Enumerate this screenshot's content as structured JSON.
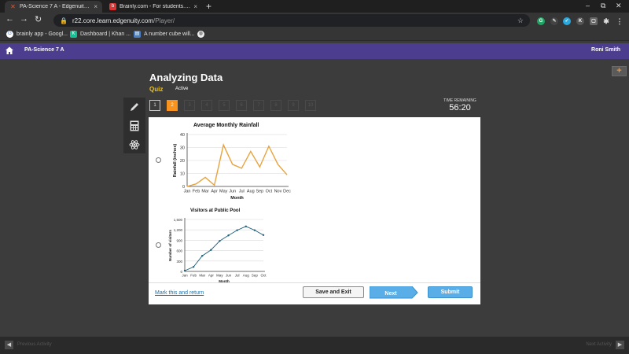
{
  "browser": {
    "tabs": [
      {
        "title": "PA-Science 7 A - Edgenuity.com",
        "active": true
      },
      {
        "title": "Brainly.com - For students. By st",
        "active": false
      }
    ],
    "url_host": "r22.core.learn.edgenuity.com",
    "url_path": "/Player/",
    "bookmarks": [
      "brainly app - Googl...",
      "Dashboard | Khan ...",
      "A number cube will..."
    ]
  },
  "header": {
    "course": "PA-Science 7 A",
    "user": "Roni Smith"
  },
  "activity": {
    "title": "Analyzing Data",
    "type": "Quiz",
    "status": "Active"
  },
  "questions": [
    "1",
    "2",
    "3",
    "4",
    "5",
    "6",
    "7",
    "8",
    "9",
    "10"
  ],
  "current_question": 2,
  "timer": {
    "label": "TIME REMAINING",
    "value": "56:20"
  },
  "footer": {
    "mark_link": "Mark this and return",
    "save_exit": "Save and Exit",
    "next": "Next",
    "submit": "Submit"
  },
  "bottom": {
    "prev_label": "Previous Activity",
    "next_label": "Next Activity"
  },
  "colors": {
    "header_purple": "#4c3d8f",
    "accent_orange": "#f7931e",
    "button_blue": "#5aaee8",
    "rainfall_line": "#e8a33d",
    "visitors_line": "#1f5f7a"
  },
  "chart_data": [
    {
      "type": "line",
      "title": "Average Monthly Rainfall",
      "xlabel": "Month",
      "ylabel": "Rainfall (inches)",
      "categories": [
        "Jan",
        "Feb",
        "Mar",
        "Apr",
        "May",
        "Jun",
        "Jul",
        "Aug",
        "Sep",
        "Oct",
        "Nov",
        "Dec"
      ],
      "series": [
        {
          "values": [
            0,
            2,
            7,
            1,
            32,
            17,
            14,
            27,
            15,
            31,
            17,
            9
          ]
        }
      ],
      "ylim": [
        0,
        40
      ],
      "yticks": [
        "0",
        "10",
        "20",
        "30",
        "40"
      ],
      "grid": true
    },
    {
      "type": "line",
      "title": "Visitors at Public Pool",
      "xlabel": "Month",
      "ylabel": "Number of visitors",
      "categories": [
        "Jan",
        "Feb",
        "Mar",
        "Apr",
        "May",
        "Jun",
        "Jul",
        "Aug",
        "Sep",
        "Oct"
      ],
      "series": [
        {
          "values": [
            20,
            130,
            450,
            620,
            880,
            1040,
            1190,
            1300,
            1190,
            1050
          ]
        }
      ],
      "ylim": [
        0,
        1500
      ],
      "yticks": [
        "0",
        "300",
        "600",
        "900",
        "1,200",
        "1,500"
      ],
      "grid": true
    }
  ]
}
